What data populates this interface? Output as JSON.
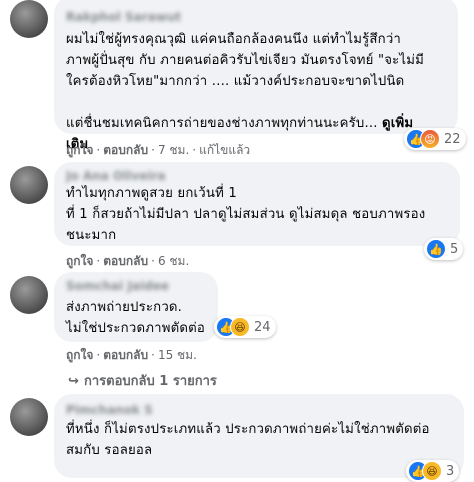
{
  "comments": [
    {
      "name": "Rakphol Sarawut",
      "text": "ผมไม่ใช่ผู้ทรงคุณวุฒิ แค่คนถือกล้องคนนึง แต่ทำไมรู้สึกว่า\nภาพผู้ปั่นสุข กับ ภายคนต่อคิวรับไข่เจียว มันตรงโจทย์ \"จะไม่มี\nใครต้องหิวโหย\"มากกว่า .... แม้วางค์ประกอบจะขาดไปนิด\n\nแต่ชื่นชมเทคนิคการถ่ายของช่างภาพทุกท่านนะครับ...",
      "see_more": "ดูเพิ่ม\nเติม",
      "actions": [
        "ถูกใจ",
        "ตอบกลับ",
        "7 ชม.",
        "แก้ไขแล้ว"
      ],
      "reaction_count": "22"
    },
    {
      "name": "Jo Ana Oliveira",
      "text": "ทำไมทุกภาพดูสวย ยกเว้นที่ 1\nที่ 1 ก็สวยถ้าไม่มีปลา ปลาดูไม่สมส่วน ดูไม่สมดุล ชอบภาพรอง\nชนะมาก",
      "actions": [
        "ถูกใจ",
        "ตอบกลับ",
        "6 ชม."
      ],
      "reaction_count": "5"
    },
    {
      "name": "Somchai Jaidee",
      "text": "ส่งภาพถ่ายประกวด.\nไม่ใช่ประกวดภาพตัดต่อ",
      "actions": [
        "ถูกใจ",
        "ตอบกลับ",
        "15 ชม."
      ],
      "reaction_count": "24",
      "replies_link": "การตอบกลับ 1 รายการ"
    },
    {
      "name": "Pimchanok S",
      "text": "ที่หนึ่ง ก็ไม่ตรงประเภทแล้ว ประกวดภาพถ่ายค่ะไม่ใช่ภาพตัดต่อ\nสมกับ รอลยอล",
      "reaction_count": "3"
    }
  ],
  "icons": {
    "like": "thumbs-up-icon",
    "angry": "angry-face-icon",
    "haha": "laughing-face-icon",
    "reply_arrow": "reply-arrow-icon"
  },
  "colors": {
    "bubble": "#f0f2f5",
    "like_blue": "#1877f2",
    "meta_grey": "#65676b"
  }
}
